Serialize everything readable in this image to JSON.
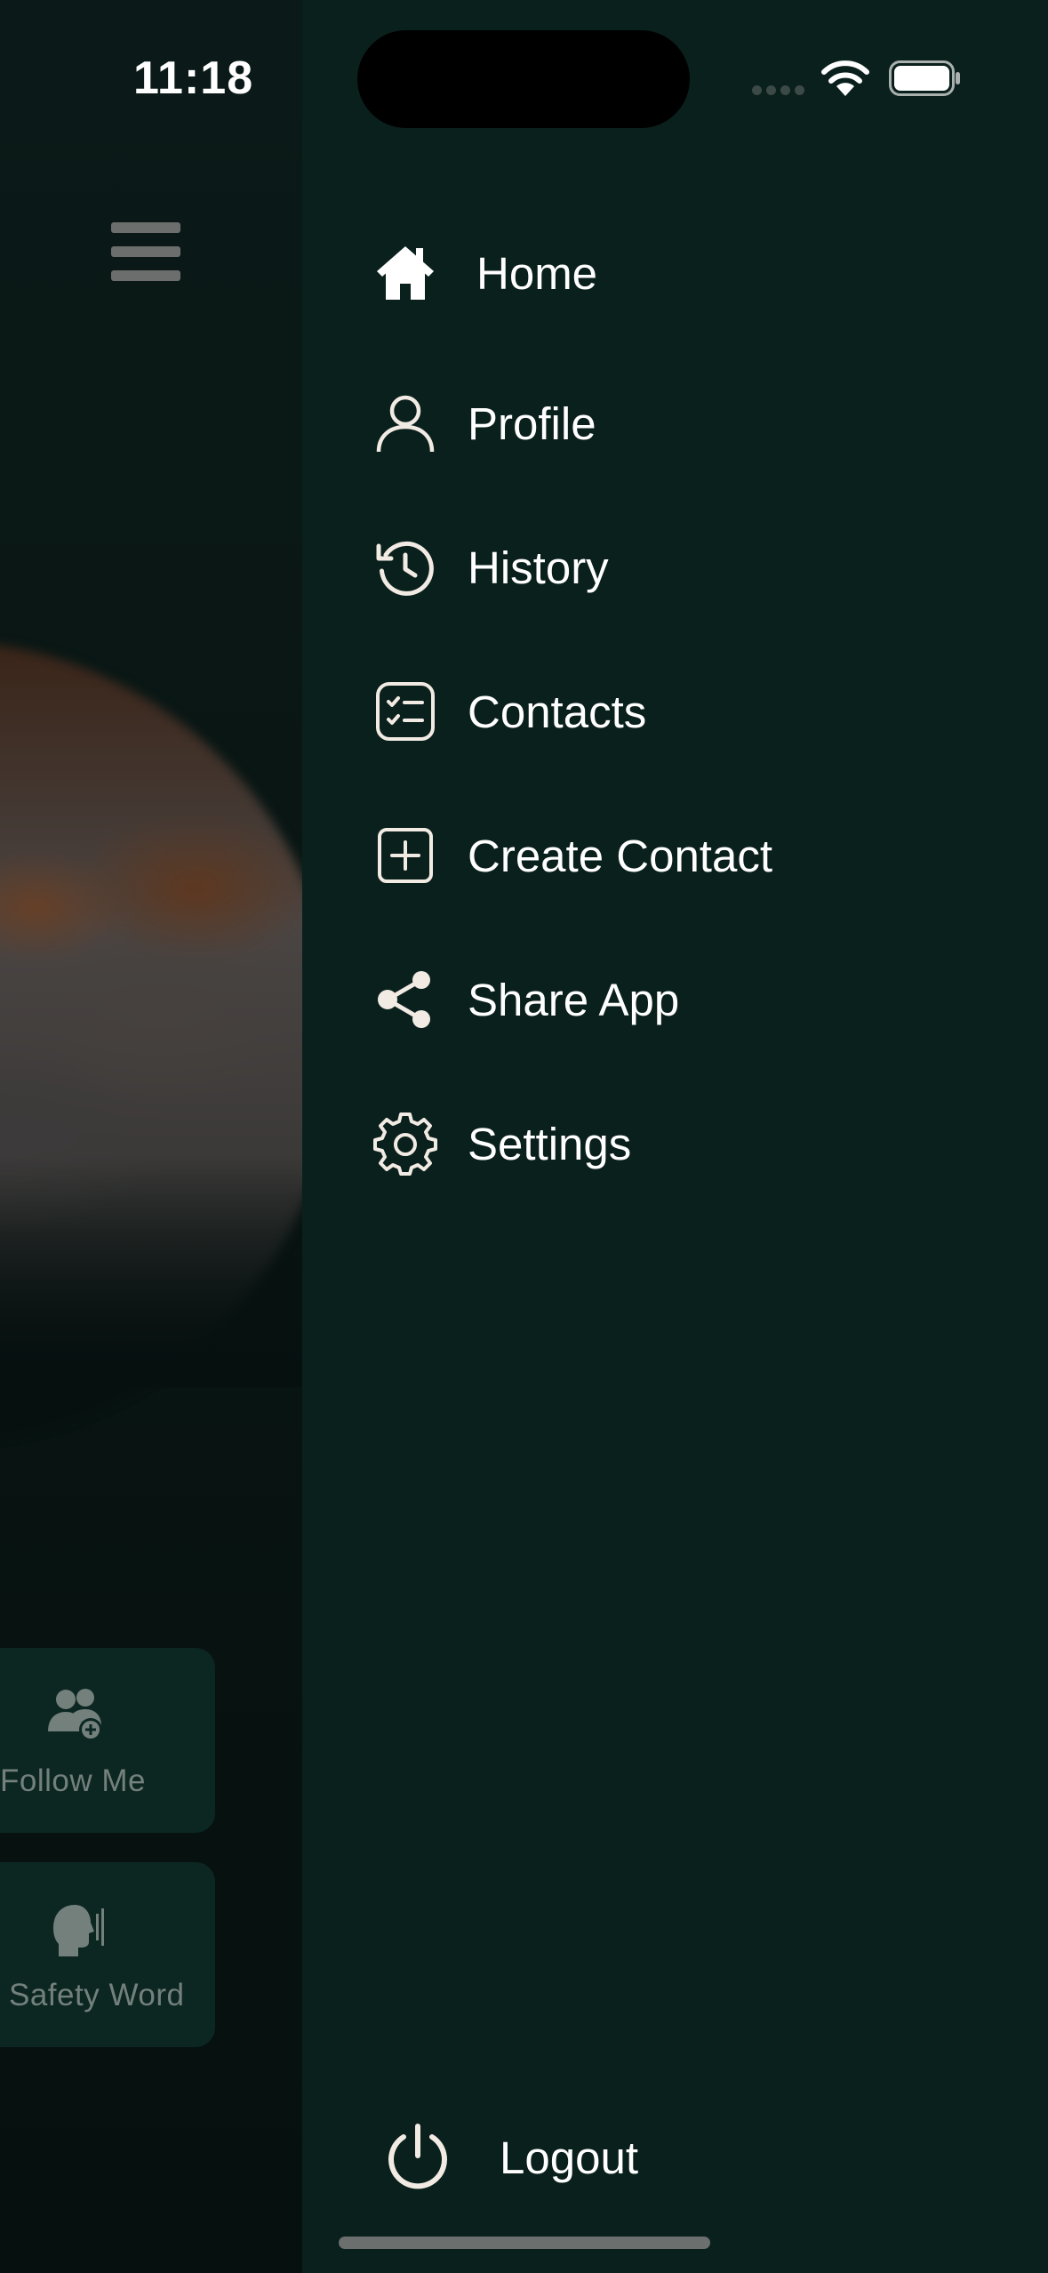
{
  "status_bar": {
    "time": "11:18"
  },
  "background_app": {
    "cards": [
      {
        "label": "Follow Me",
        "icon": "people-add-icon"
      },
      {
        "label": "Safety Word",
        "icon": "speaking-head-icon"
      }
    ]
  },
  "drawer": {
    "items": [
      {
        "label": "Home",
        "icon": "home-icon"
      },
      {
        "label": "Profile",
        "icon": "user-icon"
      },
      {
        "label": "History",
        "icon": "history-icon"
      },
      {
        "label": "Contacts",
        "icon": "checklist-icon"
      },
      {
        "label": "Create Contact",
        "icon": "plus-square-icon"
      },
      {
        "label": "Share App",
        "icon": "share-icon"
      },
      {
        "label": "Settings",
        "icon": "gear-icon"
      }
    ],
    "logout": {
      "label": "Logout",
      "icon": "power-icon"
    }
  },
  "colors": {
    "drawer_background": "#0a201c",
    "text": "#ffffff",
    "icon": "#f2ebe4",
    "card_background": "#0c2622"
  }
}
